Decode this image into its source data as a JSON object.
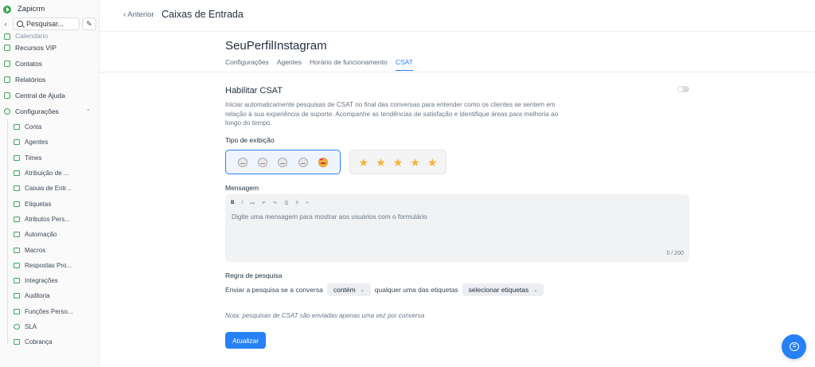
{
  "app": {
    "name": "Zapicrm",
    "search_placeholder": "Pesquisar..."
  },
  "sidebar": {
    "partial_item": "Calendário",
    "items": [
      {
        "label": "Recursos VIP",
        "icon": "crown-icon"
      },
      {
        "label": "Contatos",
        "icon": "contacts-icon"
      },
      {
        "label": "Relatórios",
        "icon": "chart-icon"
      },
      {
        "label": "Central de Ajuda",
        "icon": "book-icon"
      },
      {
        "label": "Configurações",
        "icon": "gear-icon"
      }
    ],
    "settings_items": [
      {
        "label": "Conta",
        "icon": "briefcase-icon"
      },
      {
        "label": "Agentes",
        "icon": "person-card-icon"
      },
      {
        "label": "Times",
        "icon": "people-icon"
      },
      {
        "label": "Atribuição de ...",
        "icon": "assign-icon"
      },
      {
        "label": "Caixas de Entr...",
        "icon": "inbox-icon"
      },
      {
        "label": "Etiquetas",
        "icon": "tag-icon"
      },
      {
        "label": "Atributos Pers...",
        "icon": "code-icon"
      },
      {
        "label": "Automação",
        "icon": "automation-icon"
      },
      {
        "label": "Macros",
        "icon": "macro-icon"
      },
      {
        "label": "Respostas Pro...",
        "icon": "reply-icon"
      },
      {
        "label": "Integrações",
        "icon": "plug-icon"
      },
      {
        "label": "Auditoria",
        "icon": "audit-icon"
      },
      {
        "label": "Funções Perso...",
        "icon": "role-icon"
      },
      {
        "label": "SLA",
        "icon": "clock-icon"
      },
      {
        "label": "Cobrança",
        "icon": "card-icon"
      }
    ]
  },
  "header": {
    "back_label": "Anterior",
    "title": "Caixas de Entrada"
  },
  "inbox": {
    "name": "SeuPerfilInstagram",
    "tabs": [
      "Configurações",
      "Agentes",
      "Horário de funcionamento",
      "CSAT"
    ]
  },
  "csat": {
    "title": "Habilitar CSAT",
    "description": "Iniciar automaticamente pesquisas de CSAT no final das conversas para entender como os clientes se sentem em relação à sua experiência de suporte. Acompanhe as tendências de satisfação e identifique áreas para melhoria ao longo do tempo.",
    "display_type_label": "Tipo de exibição",
    "message_label": "Mensagem",
    "message_placeholder": "Digite uma mensagem para mostrar aos usuários com o formulário",
    "counter": "0 / 200",
    "toolbar": {
      "bold": "B",
      "italic": "I",
      "link": "⊶",
      "undo": "↶",
      "redo": "↷",
      "bullets": "☰",
      "numbered": "≡",
      "code": "‹›"
    },
    "rule_label": "Regra de pesquisa",
    "rule_prefix": "Enviar a pesquisa se a conversa",
    "rule_operator": "contém",
    "rule_middle": "qualquer uma das etiquetas",
    "rule_tags": "selecionar etiquetas",
    "note": "Nota: pesquisas de CSAT são enviadas apenas uma vez por conversa",
    "submit_label": "Atualizar"
  },
  "colors": {
    "primary": "#2781f6",
    "brand_green": "#3aa655",
    "star": "#f5b335"
  }
}
